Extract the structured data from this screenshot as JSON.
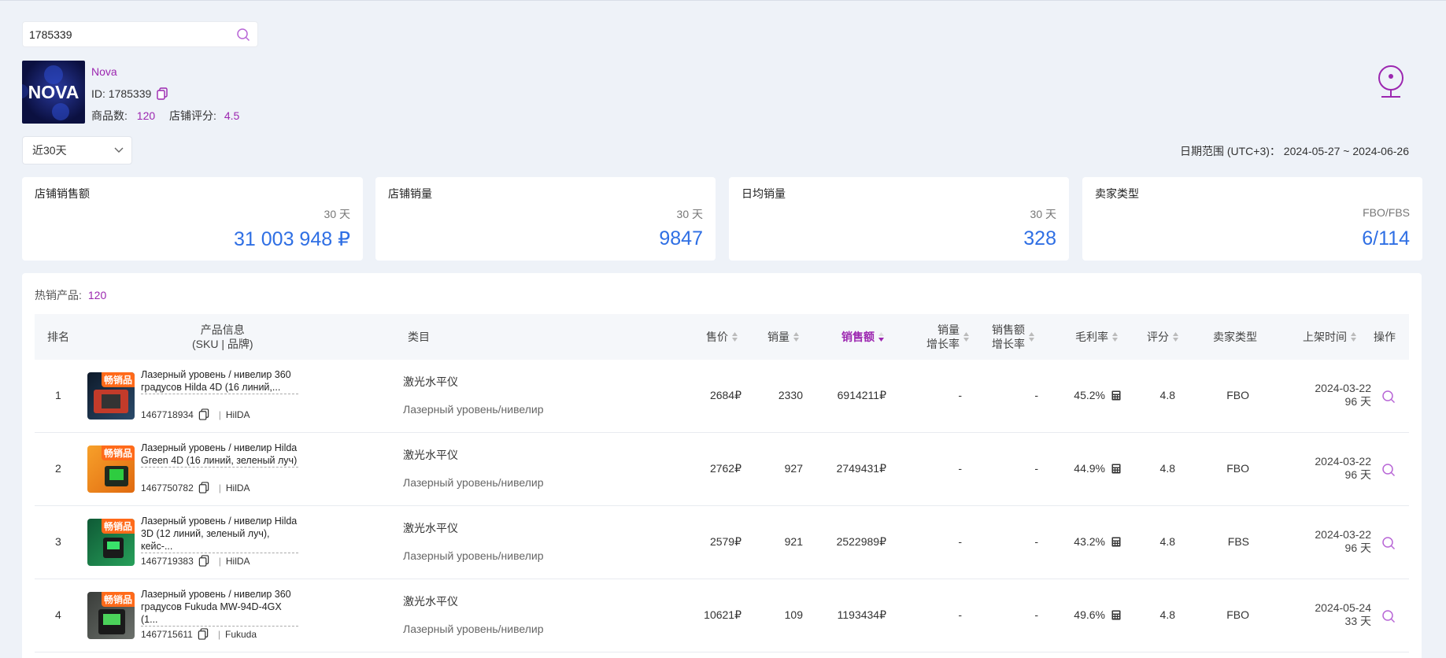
{
  "search": {
    "value": "1785339",
    "icon": "search-icon"
  },
  "shop": {
    "logo_text": "NOVA",
    "name": "Nova",
    "id_label": "ID: 1785339",
    "products_label": "商品数:",
    "products_value": "120",
    "rating_label": "店铺评分:",
    "rating_value": "4.5"
  },
  "filters": {
    "range": "近30天",
    "date_range": "日期范围 (UTC+3)： 2024-05-27 ~ 2024-06-26"
  },
  "stats": [
    {
      "title": "店铺销售额",
      "period": "30 天",
      "value": "31 003 948 ₽"
    },
    {
      "title": "店铺销量",
      "period": "30 天",
      "value": "9847"
    },
    {
      "title": "日均销量",
      "period": "30 天",
      "value": "328"
    },
    {
      "title": "卖家类型",
      "period": "FBO/FBS",
      "value": "6/114"
    }
  ],
  "table": {
    "hot_label": "热销产品:",
    "hot_count": "120",
    "headers": {
      "rank": "排名",
      "product": "产品信息",
      "product_sub": "(SKU | 品牌)",
      "category": "类目",
      "price": "售价",
      "sales": "销量",
      "revenue": "销售额",
      "sales_growth_1": "销量",
      "sales_growth_2": "增长率",
      "rev_growth_1": "销售额",
      "rev_growth_2": "增长率",
      "margin": "毛利率",
      "rating": "评分",
      "seller_type": "卖家类型",
      "listed": "上架时间",
      "action": "操作"
    },
    "badge": "畅销品",
    "accent_color": "#9c27b0",
    "rows": [
      {
        "rank": "1",
        "name": "Лазерный уровень / нивелир 360 градусов Hilda 4D (16 линий,...",
        "sku": "1467718934",
        "brand": "HilDA",
        "cat1": "激光水平仪",
        "cat2": "Лазерный уровень/нивелир",
        "price": "2684₽",
        "sales": "2330",
        "revenue": "6914211₽",
        "sales_growth": "-",
        "rev_growth": "-",
        "margin": "45.2%",
        "rating": "4.8",
        "seller_type": "FBO",
        "date": "2024-03-22",
        "days": "96 天",
        "img_color": "#1b2a3a"
      },
      {
        "rank": "2",
        "name": "Лазерный уровень / нивелир Hilda Green 4D (16 линий, зеленый луч)",
        "sku": "1467750782",
        "brand": "HilDA",
        "cat1": "激光水平仪",
        "cat2": "Лазерный уровень/нивелир",
        "price": "2762₽",
        "sales": "927",
        "revenue": "2749431₽",
        "sales_growth": "-",
        "rev_growth": "-",
        "margin": "44.9%",
        "rating": "4.8",
        "seller_type": "FBO",
        "date": "2024-03-22",
        "days": "96 天",
        "img_color": "#f08a1c"
      },
      {
        "rank": "3",
        "name": "Лазерный уровень / нивелир Hilda 3D (12 линий, зеленый луч), кейс-...",
        "sku": "1467719383",
        "brand": "HilDA",
        "cat1": "激光水平仪",
        "cat2": "Лазерный уровень/нивелир",
        "price": "2579₽",
        "sales": "921",
        "revenue": "2522989₽",
        "sales_growth": "-",
        "rev_growth": "-",
        "margin": "43.2%",
        "rating": "4.8",
        "seller_type": "FBS",
        "date": "2024-03-22",
        "days": "96 天",
        "img_color": "#1f7a4a"
      },
      {
        "rank": "4",
        "name": "Лазерный уровень / нивелир 360 градусов Fukuda MW-94D-4GX (1...",
        "sku": "1467715611",
        "brand": "Fukuda",
        "cat1": "激光水平仪",
        "cat2": "Лазерный уровень/нивелир",
        "price": "10621₽",
        "sales": "109",
        "revenue": "1193434₽",
        "sales_growth": "-",
        "rev_growth": "-",
        "margin": "49.6%",
        "rating": "4.8",
        "seller_type": "FBO",
        "date": "2024-05-24",
        "days": "33 天",
        "img_color": "#4a4f4a"
      }
    ]
  }
}
